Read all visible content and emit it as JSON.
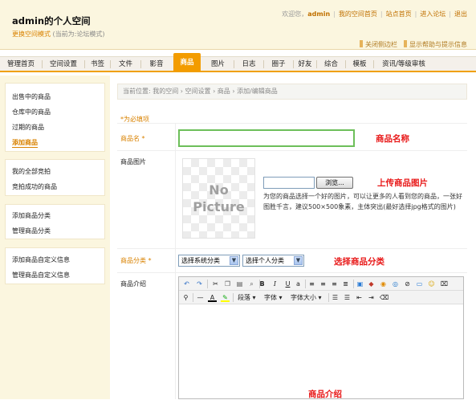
{
  "header": {
    "site_title": "admin的个人空间",
    "switch_link": "更换空间模式",
    "current_mode": "(当前为:论坛模式)",
    "welcome": "欢迎您，",
    "username": "admin",
    "my_space": "我的空间首页",
    "site_home": "站点首页",
    "enter_forum": "进入论坛",
    "logout": "退出",
    "close_sidebar": "关闭侧边栏",
    "show_help": "显示帮助与提示信息"
  },
  "nav": {
    "tabs": [
      "管理首页",
      "空间设置",
      "书签",
      "文件",
      "影音",
      "商品",
      "图片",
      "日志",
      "圈子",
      "好友",
      "综合",
      "模板",
      "资讯/等级审核"
    ],
    "active": "商品"
  },
  "sidebar": {
    "group1": [
      "出售中的商品",
      "仓库中的商品",
      "过期的商品",
      "添加商品"
    ],
    "active": "添加商品",
    "group2": [
      "我的全部竞拍",
      "竞拍成功的商品"
    ],
    "group3": [
      "添加商品分类",
      "管理商品分类"
    ],
    "group4": [
      "添加商品自定义信息",
      "管理商品自定义信息"
    ]
  },
  "breadcrumb": "当前位置: 我的空间 › 空间设置 › 商品 › 添加/编辑商品",
  "form": {
    "required_note": "*为必填项",
    "name_label": "商品名 *",
    "name_value": "",
    "name_annotation": "商品名称",
    "image_label": "商品图片",
    "no_picture": [
      "No",
      "Picture"
    ],
    "browse_label": "浏览...",
    "image_annotation": "上传商品图片",
    "image_note": "为您的商品选择一个好的图片，可以让更多的人看到您的商品，一张好图胜千言，建议500×500象素，主体突出(最好选择jpg格式的图片)",
    "category_label": "商品分类 *",
    "system_category": "选择系统分类",
    "personal_category": "选择个人分类",
    "category_annotation": "选择商品分类",
    "intro_label": "商品介绍",
    "intro_annotation": "商品介绍"
  },
  "editor": {
    "paragraph": "段落",
    "font": "字体",
    "font_size": "字体大小"
  },
  "colors": {
    "accent": "#f39c00",
    "annotation": "#e81818",
    "header_bg": "#fbf6df"
  }
}
